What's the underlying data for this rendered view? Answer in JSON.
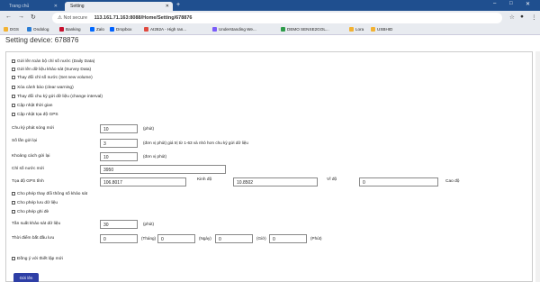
{
  "browser": {
    "tabs": [
      {
        "label": "Trang chủ"
      },
      {
        "label": "Setting"
      }
    ],
    "new_tab": "+",
    "window_controls": [
      "–",
      "□",
      "✕"
    ],
    "address": {
      "security": "Not secure",
      "url": "113.161.71.163:8088/Home/Setting/678876"
    },
    "bookmarks": [
      {
        "label": "DGS",
        "color": "#f2b233"
      },
      {
        "label": "Ondolog",
        "color": "#2b7cd3"
      },
      {
        "label": "Banking",
        "color": "#c8102e"
      },
      {
        "label": "Zalo",
        "color": "#0068ff"
      },
      {
        "label": "Dropbox",
        "color": "#0061fe"
      },
      {
        "label": "AI282A - High ran...",
        "color": "#e04a3f"
      },
      {
        "label": "Understanding We...",
        "color": "#7a5cfa"
      },
      {
        "label": "DEMO SENSE2GOL...",
        "color": "#2e9c4a"
      },
      {
        "label": "Lora",
        "color": "#f2b233"
      },
      {
        "label": "USBHID",
        "color": "#f2b233"
      }
    ]
  },
  "page": {
    "heading": "Setting device: 678876",
    "checkboxes": [
      {
        "label": "Gửi lên toàn bộ chỉ số nước (Daily Data)"
      },
      {
        "label": "Gửi lên dữ liệu khảo sát (Survey Data)"
      },
      {
        "label": "Thay đổi chỉ số nước (Set new volume)"
      },
      {
        "label": "Xóa cảnh báo (clear warning)"
      },
      {
        "label": "Thay đổi chu kỳ gửi dữ liệu (change interval)"
      },
      {
        "label": "Cập nhật thời gian"
      },
      {
        "label": "Cập nhật tọa độ GPS"
      }
    ],
    "fields": {
      "chu_ky_label": "Chu kỳ phát sóng mới",
      "chu_ky_value": "10",
      "chu_ky_unit": "(phút)",
      "so_lan_label": "Số lần gửi lại",
      "so_lan_value": "3",
      "so_lan_hint": "(đơn vị phút) giá trị từ 1-63 và nhỏ hơn chu kỳ gửi dữ liệu",
      "khoang_label": "Khoảng cách gửi lại",
      "khoang_value": "10",
      "khoang_unit": "(đơn vị phút)",
      "chiso_label": "Chỉ số nước mới",
      "chiso_value": "3950",
      "gps_label": "Tọa độ GPS tĩnh",
      "gps_lon_value": "106.8017",
      "kinh_do_label": "Kinh độ",
      "kinh_do_value": "10.8502",
      "vi_do_label": "Vĩ độ",
      "vi_do_value": "0",
      "cao_do_label": "Cao độ"
    },
    "checkboxes2": [
      {
        "label": "Cho phép thay đổi thông số khảo sát"
      },
      {
        "label": "Cho phép lưu dữ liệu"
      },
      {
        "label": "Cho phép ghi đè"
      }
    ],
    "survey": {
      "tan_suat_label": "Tần suất khảo sát dữ liệu",
      "tan_suat_value": "30",
      "tan_suat_unit": "(phút)",
      "thoi_diem_label": "Thời điểm bắt đầu lưu",
      "thang_value": "0",
      "thang_unit": "(Tháng)",
      "ngay_value": "0",
      "ngay_unit": "(Ngày)",
      "gio_value": "0",
      "gio_unit": "(Giờ)",
      "phut_value": "0",
      "phut_unit": "(Phút)"
    },
    "agree_label": "Đồng ý với thiết lập mới",
    "submit_label": "Gửi lên"
  }
}
